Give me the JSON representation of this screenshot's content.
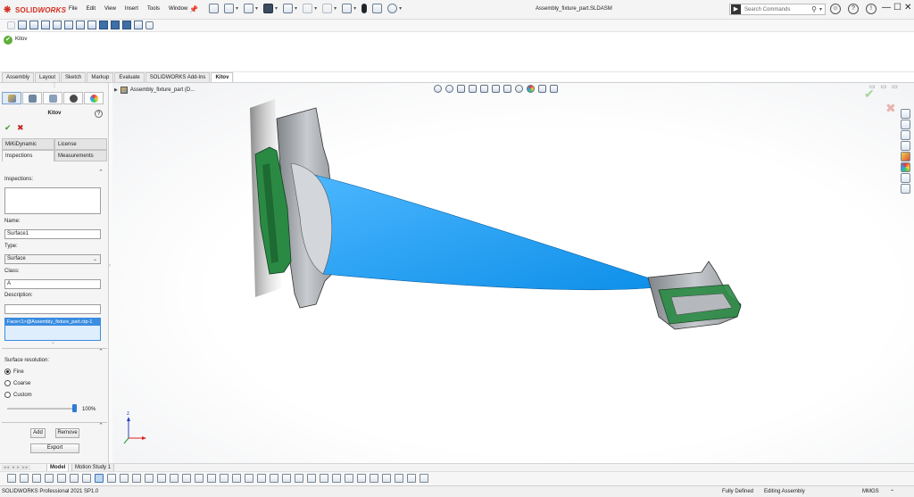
{
  "app": {
    "logo_text_ds": "3DS",
    "logo_text_solid": "SOLID",
    "logo_text_works": "WORKS",
    "document_title": "Assembly_fixture_part.SLDASM"
  },
  "menu": {
    "items": [
      "File",
      "Edit",
      "View",
      "Insert",
      "Tools",
      "Window"
    ]
  },
  "search": {
    "placeholder": "Search Commands"
  },
  "window_buttons": {
    "minimize": "—",
    "restore": "☐",
    "close": "✕"
  },
  "property_manager": {
    "feature_name": "Kitov"
  },
  "command_tabs": {
    "items": [
      "Assembly",
      "Layout",
      "Sketch",
      "Markup",
      "Evaluate",
      "SOLIDWORKS Add-Ins",
      "Kitov"
    ],
    "active": "Kitov"
  },
  "left_panel": {
    "title": "Kitov",
    "help": "?",
    "tabs_row1": [
      "MiKiDynamic",
      "License"
    ],
    "tabs_row2": [
      "Inspections",
      "Measurements"
    ],
    "inspections_label": "Inspections:",
    "name_label": "Name:",
    "name_value": "Surface1",
    "type_label": "Type:",
    "type_value": "Surface",
    "class_label": "Class:",
    "class_value": "A",
    "description_label": "Description:",
    "description_value": "",
    "selected_face": "Face<1>@Assembly_fixture_part.ctp-1",
    "surface_resolution_label": "Surface resolution:",
    "resolution_options": [
      "Fine",
      "Coarse",
      "Custom"
    ],
    "resolution_selected": "Fine",
    "slider_value_text": "100%",
    "slider_fraction": 1.0,
    "add_button": "Add",
    "remove_button": "Remove",
    "export_button": "Export"
  },
  "viewport": {
    "tree_root": "Assembly_fixture_part  (D..."
  },
  "bottom_tabs": {
    "items": [
      "Model",
      "Motion Study 1"
    ],
    "active": "Model"
  },
  "status_bar": {
    "product": "SOLIDWORKS Professional 2021 SP1.0",
    "definition": "Fully Defined",
    "mode": "Editing Assembly",
    "units": "MMGS"
  },
  "colors": {
    "blade": "#1e9ef5",
    "fixture_green": "#2a8a44",
    "fixture_gray": "#a4a8ad",
    "logo_red": "#d52b1e",
    "selection_blue": "#3a8de1"
  }
}
